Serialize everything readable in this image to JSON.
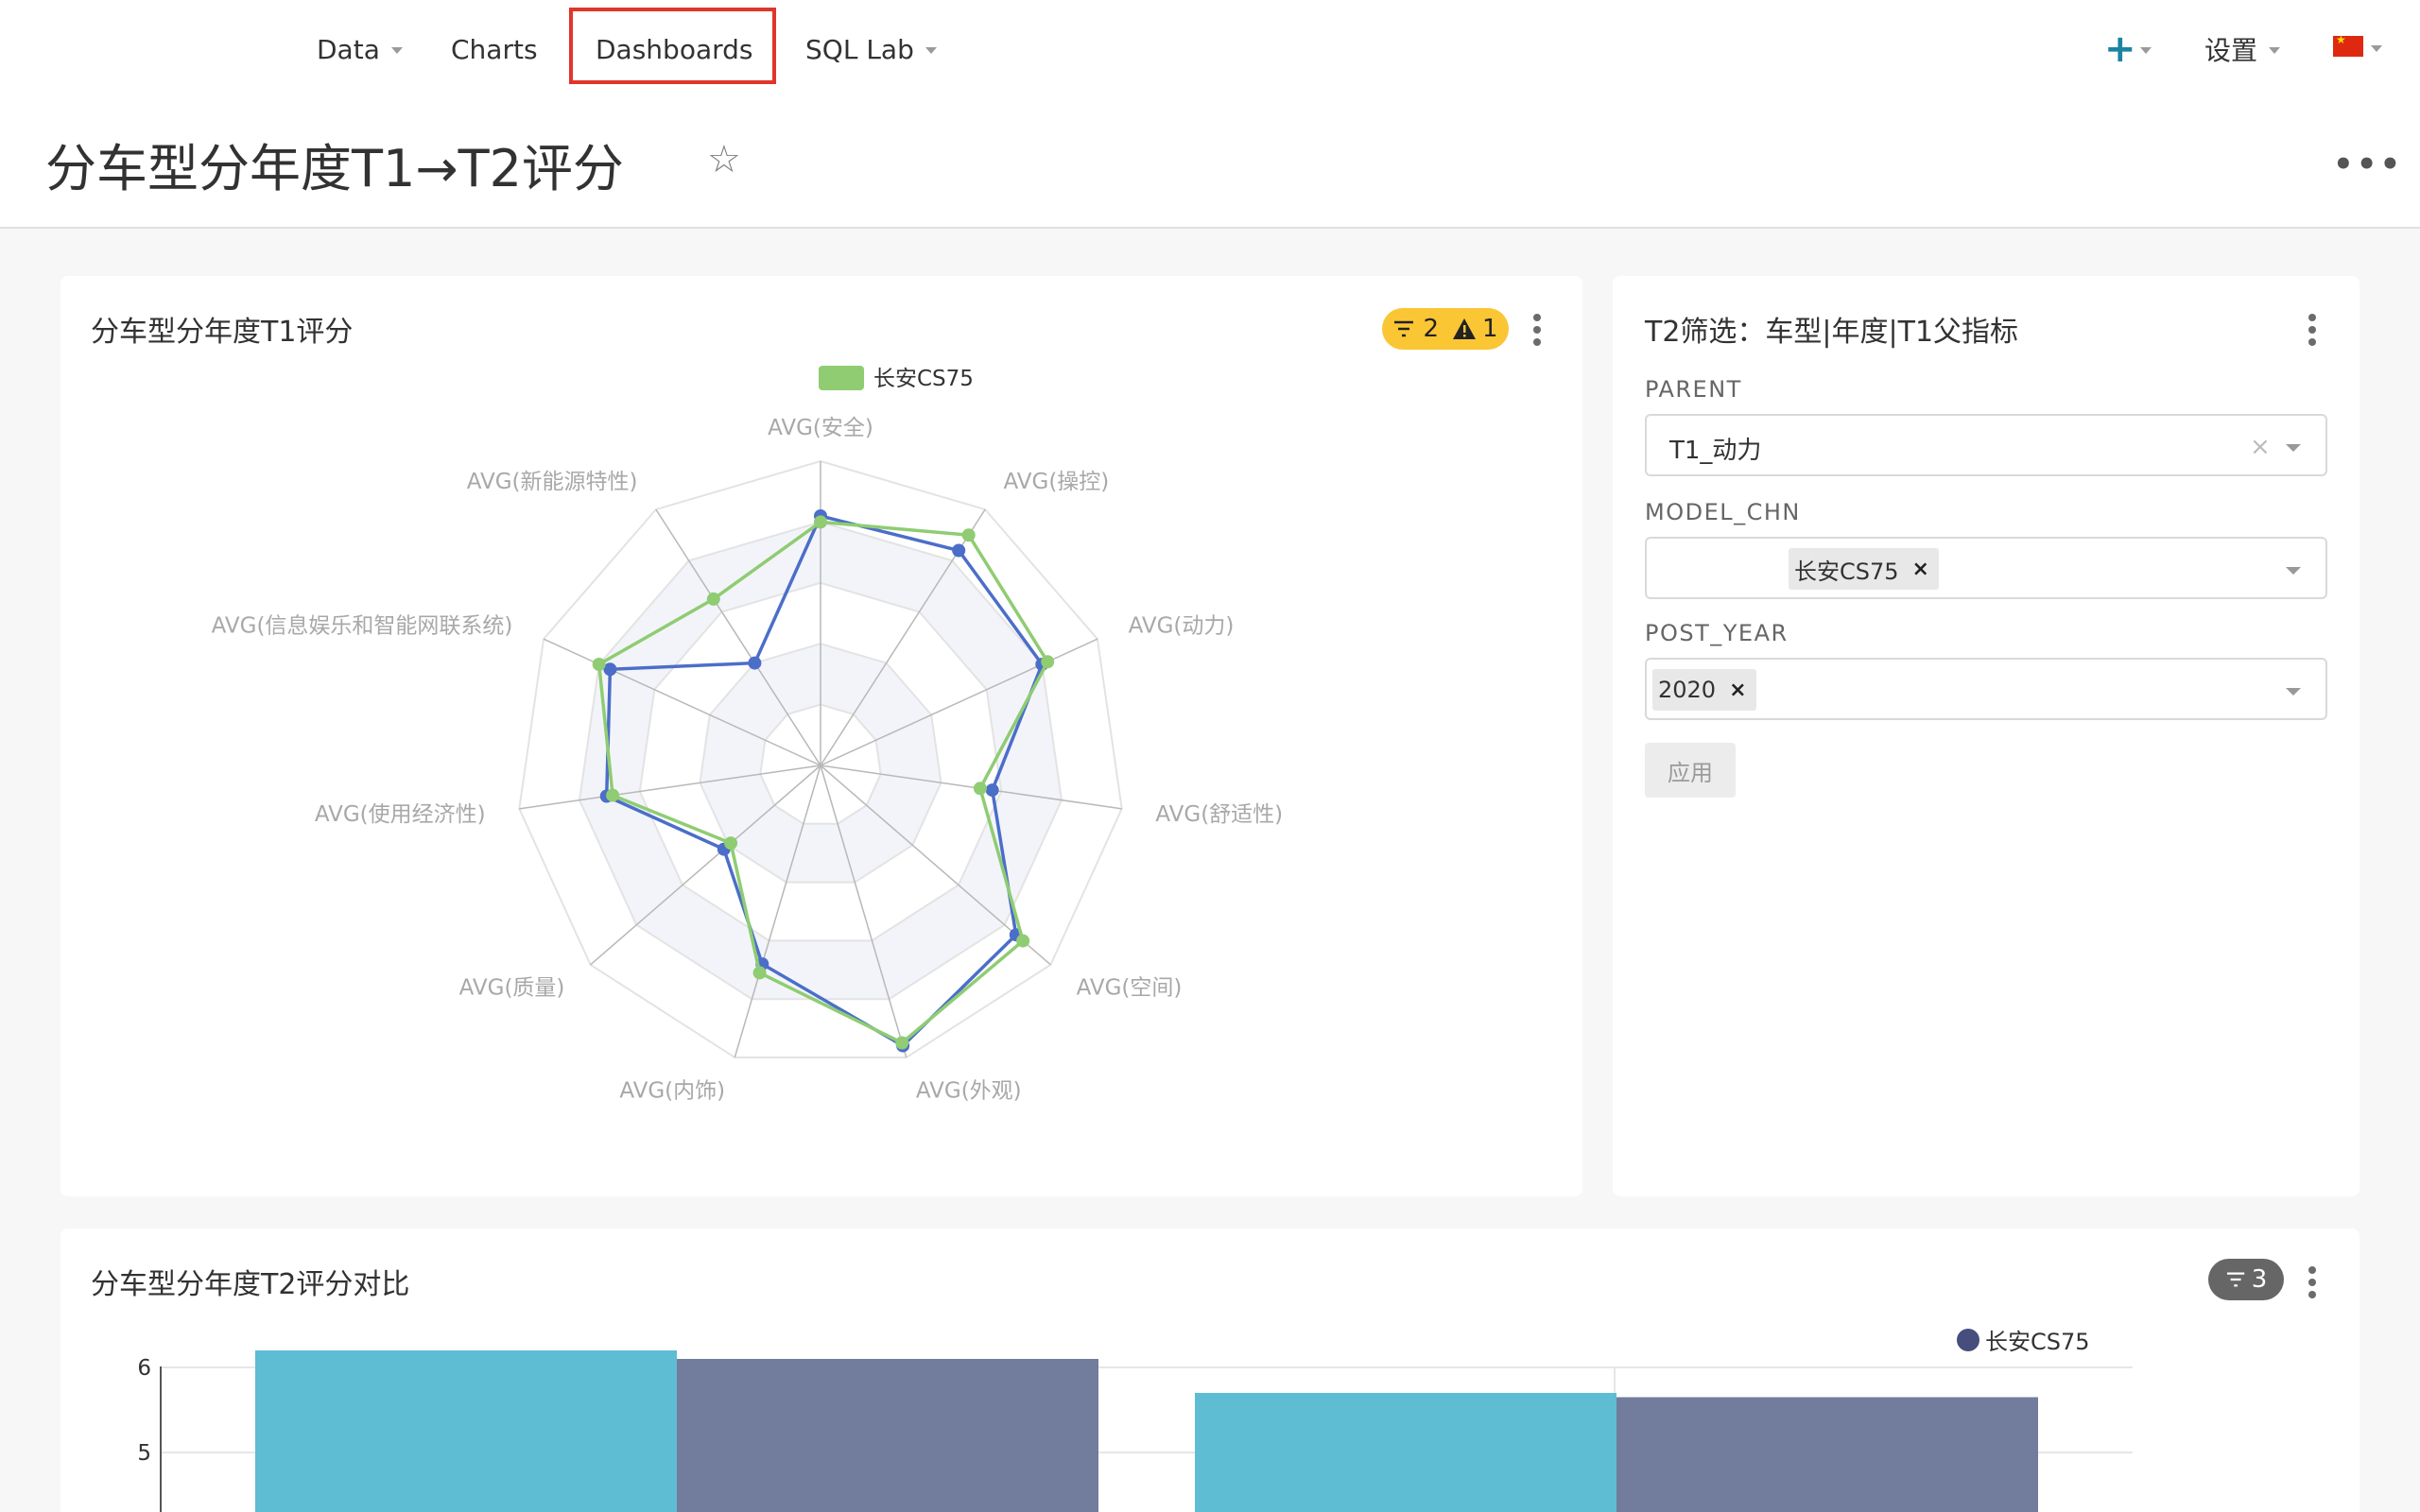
{
  "nav": {
    "items": [
      {
        "label": "Data"
      },
      {
        "label": "Charts"
      },
      {
        "label": "Dashboards"
      },
      {
        "label": "SQL Lab"
      }
    ],
    "settings_label": "设置"
  },
  "page": {
    "title": "分车型分年度T1→T2评分"
  },
  "radar_card": {
    "title": "分车型分年度T1评分",
    "badge_filters": "2",
    "badge_alerts": "1"
  },
  "filter_card": {
    "title": "T2筛选：车型|年度|T1父指标",
    "parent_label": "PARENT",
    "parent_value": "T1_动力",
    "model_label": "MODEL_CHN",
    "model_tag": "长安CS75",
    "year_label": "POST_YEAR",
    "year_tag": "2020",
    "apply_label": "应用"
  },
  "bar_card": {
    "title": "分车型分年度T2评分对比",
    "badge_filters": "3"
  },
  "colors": {
    "radar_series_1": "#4b6ec9",
    "radar_series_2": "#8fcc72",
    "bar_teal": "#5ebcd3",
    "bar_navy": "#727c9c",
    "nav_highlight": "#e0352b",
    "badge_yellow": "#fbc634"
  },
  "chart_data": [
    {
      "type": "radar",
      "legend": [
        "长安CS75"
      ],
      "axes": [
        "AVG(安全)",
        "AVG(操控)",
        "AVG(动力)",
        "AVG(舒适性)",
        "AVG(空间)",
        "AVG(外观)",
        "AVG(内饰)",
        "AVG(质量)",
        "AVG(使用经济性)",
        "AVG(信息娱乐和智能网联系统)",
        "AVG(新能源特性)"
      ],
      "series": [
        {
          "name": "",
          "color": "#4b6ec9",
          "values": [
            0.82,
            0.84,
            0.8,
            0.57,
            0.85,
            0.96,
            0.68,
            0.42,
            0.71,
            0.76,
            0.4
          ]
        },
        {
          "name": "长安CS75",
          "color": "#8fcc72",
          "values": [
            0.8,
            0.9,
            0.82,
            0.53,
            0.88,
            0.95,
            0.71,
            0.39,
            0.69,
            0.8,
            0.65
          ]
        }
      ],
      "grid_rings": 5
    },
    {
      "type": "bar",
      "legend": [
        "长安CS75"
      ],
      "y_ticks": [
        "6",
        "5"
      ],
      "series": [
        {
          "color": "#5ebcd3",
          "values": [
            6.2,
            5.7
          ]
        },
        {
          "name": "长安CS75",
          "color": "#727c9c",
          "values": [
            6.1,
            5.65
          ]
        }
      ],
      "ylim_visible": [
        4.3,
        6.3
      ]
    }
  ]
}
